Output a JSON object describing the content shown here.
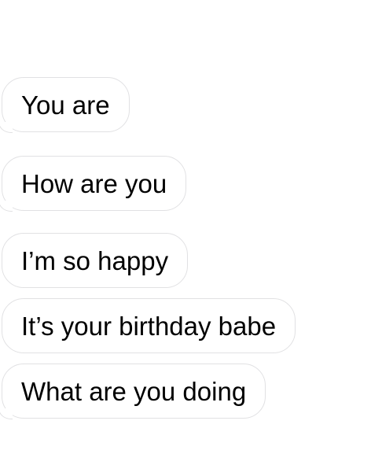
{
  "messages": [
    {
      "text": "You are"
    },
    {
      "text": "How are you"
    },
    {
      "text": "I’m so happy"
    },
    {
      "text": "It’s your birthday babe"
    },
    {
      "text": "What are you doing"
    }
  ]
}
